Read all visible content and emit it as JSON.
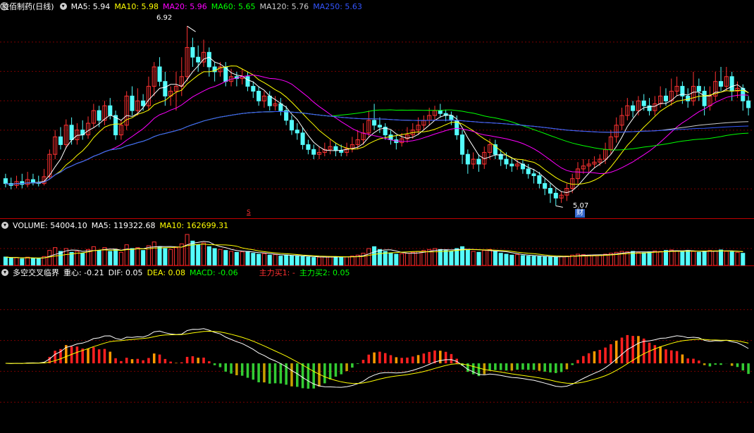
{
  "main": {
    "title": "益佰制药(日线)",
    "ma": [
      {
        "label": "MA5: 5.94",
        "color": "#ffffff"
      },
      {
        "label": "MA10: 5.98",
        "color": "#ffff00"
      },
      {
        "label": "MA20: 5.96",
        "color": "#ff00ff"
      },
      {
        "label": "MA60: 5.65",
        "color": "#00ff00"
      },
      {
        "label": "MA120: 5.76",
        "color": "#cccccc"
      },
      {
        "label": "MA250: 5.63",
        "color": "#3355ff"
      }
    ],
    "high_label": "6.92",
    "low_label": "5.07",
    "marker_s": "S",
    "marker_cai": "财"
  },
  "volume": {
    "items": [
      {
        "label": "VOLUME: 54004.10",
        "color": "#ffffff"
      },
      {
        "label": "MA5: 119322.68",
        "color": "#ffffff"
      },
      {
        "label": "MA10: 162699.31",
        "color": "#ffff00"
      }
    ]
  },
  "indicator": {
    "items": [
      {
        "label": "多空交叉临界",
        "color": "#ffffff"
      },
      {
        "label": "重心: -0.21",
        "color": "#ffffff"
      },
      {
        "label": "DIF: 0.05",
        "color": "#ffffff"
      },
      {
        "label": "DEA: 0.08",
        "color": "#ffff00"
      },
      {
        "label": "MACD: -0.06",
        "color": "#00ff00"
      },
      {
        "label": "主力买1: -",
        "color": "#ff3030"
      },
      {
        "label": "主力买2: 0.05",
        "color": "#00ff00"
      }
    ]
  },
  "colors": {
    "up": "#ff3232",
    "down": "#54fcfc",
    "grid": "#7a0000",
    "separator": "#c00000"
  },
  "chart_data": {
    "type": "candlestick",
    "title": "益佰制药(日线)",
    "price_range": [
      5.0,
      7.0
    ],
    "candles": [
      [
        5.35,
        5.3,
        5.4,
        5.26
      ],
      [
        5.3,
        5.28,
        5.36,
        5.24
      ],
      [
        5.28,
        5.32,
        5.38,
        5.25
      ],
      [
        5.32,
        5.29,
        5.4,
        5.25
      ],
      [
        5.29,
        5.34,
        5.42,
        5.26
      ],
      [
        5.34,
        5.31,
        5.4,
        5.28
      ],
      [
        5.31,
        5.3,
        5.38,
        5.27
      ],
      [
        5.3,
        5.37,
        5.45,
        5.28
      ],
      [
        5.37,
        5.6,
        5.65,
        5.35
      ],
      [
        5.6,
        5.78,
        5.85,
        5.55
      ],
      [
        5.78,
        5.7,
        5.88,
        5.65
      ],
      [
        5.7,
        5.9,
        5.96,
        5.66
      ],
      [
        5.9,
        5.75,
        5.98,
        5.7
      ],
      [
        5.75,
        5.85,
        5.92,
        5.7
      ],
      [
        5.85,
        5.8,
        5.95,
        5.75
      ],
      [
        5.8,
        5.92,
        5.99,
        5.76
      ],
      [
        5.92,
        6.05,
        6.12,
        5.88
      ],
      [
        6.05,
        5.95,
        6.1,
        5.88
      ],
      [
        5.95,
        6.1,
        6.15,
        5.9
      ],
      [
        6.1,
        6.0,
        6.18,
        5.96
      ],
      [
        6.0,
        5.8,
        6.05,
        5.75
      ],
      [
        5.8,
        5.9,
        5.95,
        5.75
      ],
      [
        5.9,
        6.2,
        6.25,
        5.85
      ],
      [
        6.2,
        6.05,
        6.3,
        6.0
      ],
      [
        6.05,
        6.15,
        6.28,
        6.0
      ],
      [
        6.15,
        6.1,
        6.22,
        6.05
      ],
      [
        6.1,
        6.3,
        6.4,
        6.05
      ],
      [
        6.3,
        6.5,
        6.55,
        6.2
      ],
      [
        6.5,
        6.35,
        6.6,
        6.3
      ],
      [
        6.35,
        6.2,
        6.45,
        6.1
      ],
      [
        6.2,
        6.25,
        6.3,
        6.1
      ],
      [
        6.25,
        6.3,
        6.45,
        6.05
      ],
      [
        6.3,
        6.4,
        6.6,
        6.2
      ],
      [
        6.4,
        6.7,
        6.92,
        6.35
      ],
      [
        6.7,
        6.6,
        6.8,
        6.5
      ],
      [
        6.6,
        6.55,
        6.72,
        6.45
      ],
      [
        6.55,
        6.65,
        6.78,
        6.5
      ],
      [
        6.65,
        6.5,
        6.7,
        6.4
      ],
      [
        6.5,
        6.45,
        6.55,
        6.35
      ],
      [
        6.45,
        6.5,
        6.55,
        6.4
      ],
      [
        6.5,
        6.35,
        6.55,
        6.3
      ],
      [
        6.35,
        6.4,
        6.48,
        6.3
      ],
      [
        6.4,
        6.38,
        6.45,
        6.3
      ],
      [
        6.38,
        6.4,
        6.48,
        6.32
      ],
      [
        6.4,
        6.3,
        6.45,
        6.25
      ],
      [
        6.3,
        6.25,
        6.35,
        6.18
      ],
      [
        6.25,
        6.15,
        6.3,
        6.1
      ],
      [
        6.15,
        6.2,
        6.25,
        6.08
      ],
      [
        6.2,
        6.1,
        6.25,
        6.05
      ],
      [
        6.1,
        6.12,
        6.2,
        6.05
      ],
      [
        6.12,
        6.05,
        6.18,
        6.0
      ],
      [
        6.05,
        5.95,
        6.1,
        5.9
      ],
      [
        5.95,
        5.85,
        6.0,
        5.8
      ],
      [
        5.85,
        5.82,
        5.92,
        5.75
      ],
      [
        5.82,
        5.7,
        5.88,
        5.65
      ],
      [
        5.7,
        5.65,
        5.75,
        5.6
      ],
      [
        5.65,
        5.6,
        5.7,
        5.55
      ],
      [
        5.6,
        5.62,
        5.68,
        5.55
      ],
      [
        5.62,
        5.65,
        5.72,
        5.58
      ],
      [
        5.65,
        5.68,
        5.75,
        5.6
      ],
      [
        5.68,
        5.64,
        5.72,
        5.58
      ],
      [
        5.64,
        5.62,
        5.7,
        5.58
      ],
      [
        5.62,
        5.66,
        5.72,
        5.58
      ],
      [
        5.66,
        5.7,
        5.78,
        5.62
      ],
      [
        5.7,
        5.75,
        5.85,
        5.65
      ],
      [
        5.75,
        5.82,
        5.92,
        5.7
      ],
      [
        5.82,
        5.95,
        6.05,
        5.78
      ],
      [
        5.95,
        5.9,
        6.12,
        5.85
      ],
      [
        5.9,
        5.88,
        5.98,
        5.82
      ],
      [
        5.88,
        5.8,
        5.92,
        5.75
      ],
      [
        5.8,
        5.75,
        5.85,
        5.7
      ],
      [
        5.75,
        5.72,
        5.8,
        5.65
      ],
      [
        5.72,
        5.76,
        5.82,
        5.68
      ],
      [
        5.76,
        5.8,
        5.88,
        5.72
      ],
      [
        5.8,
        5.85,
        5.92,
        5.76
      ],
      [
        5.85,
        5.9,
        5.98,
        5.8
      ],
      [
        5.9,
        5.95,
        6.0,
        5.85
      ],
      [
        5.95,
        6.0,
        6.08,
        5.9
      ],
      [
        6.0,
        6.05,
        6.1,
        5.95
      ],
      [
        6.05,
        6.02,
        6.12,
        5.98
      ],
      [
        6.02,
        6.0,
        6.06,
        5.94
      ],
      [
        6.0,
        5.95,
        6.04,
        5.9
      ],
      [
        5.95,
        5.8,
        6.0,
        5.75
      ],
      [
        5.8,
        5.6,
        5.85,
        5.5
      ],
      [
        5.6,
        5.5,
        5.65,
        5.4
      ],
      [
        5.5,
        5.55,
        5.62,
        5.45
      ],
      [
        5.55,
        5.5,
        5.6,
        5.42
      ],
      [
        5.5,
        5.62,
        5.68,
        5.45
      ],
      [
        5.62,
        5.7,
        5.76,
        5.55
      ],
      [
        5.7,
        5.6,
        5.75,
        5.55
      ],
      [
        5.6,
        5.55,
        5.65,
        5.48
      ],
      [
        5.55,
        5.5,
        5.62,
        5.45
      ],
      [
        5.5,
        5.48,
        5.56,
        5.42
      ],
      [
        5.48,
        5.5,
        5.55,
        5.44
      ],
      [
        5.5,
        5.45,
        5.54,
        5.4
      ],
      [
        5.45,
        5.4,
        5.5,
        5.35
      ],
      [
        5.4,
        5.38,
        5.45,
        5.3
      ],
      [
        5.38,
        5.3,
        5.42,
        5.25
      ],
      [
        5.3,
        5.25,
        5.35,
        5.18
      ],
      [
        5.25,
        5.2,
        5.3,
        5.1
      ],
      [
        5.2,
        5.15,
        5.25,
        5.07
      ],
      [
        5.15,
        5.18,
        5.22,
        5.1
      ],
      [
        5.18,
        5.25,
        5.3,
        5.12
      ],
      [
        5.25,
        5.35,
        5.4,
        5.2
      ],
      [
        5.35,
        5.45,
        5.52,
        5.3
      ],
      [
        5.45,
        5.48,
        5.55,
        5.4
      ],
      [
        5.48,
        5.5,
        5.55,
        5.42
      ],
      [
        5.5,
        5.52,
        5.58,
        5.46
      ],
      [
        5.52,
        5.55,
        5.6,
        5.48
      ],
      [
        5.55,
        5.65,
        5.72,
        5.5
      ],
      [
        5.65,
        5.78,
        5.85,
        5.6
      ],
      [
        5.78,
        5.9,
        5.98,
        5.72
      ],
      [
        5.9,
        6.0,
        6.08,
        5.85
      ],
      [
        6.0,
        6.1,
        6.18,
        5.95
      ],
      [
        6.1,
        6.05,
        6.15,
        5.98
      ],
      [
        6.05,
        6.15,
        6.2,
        6.0
      ],
      [
        6.15,
        6.1,
        6.22,
        6.05
      ],
      [
        6.1,
        6.05,
        6.18,
        6.0
      ],
      [
        6.05,
        6.12,
        6.2,
        6.0
      ],
      [
        6.12,
        6.2,
        6.3,
        6.08
      ],
      [
        6.2,
        6.15,
        6.28,
        6.1
      ],
      [
        6.15,
        6.25,
        6.38,
        6.1
      ],
      [
        6.25,
        6.3,
        6.4,
        6.2
      ],
      [
        6.3,
        6.2,
        6.35,
        6.12
      ],
      [
        6.2,
        6.15,
        6.28,
        6.08
      ],
      [
        6.15,
        6.3,
        6.45,
        6.1
      ],
      [
        6.3,
        6.25,
        6.38,
        6.15
      ],
      [
        6.25,
        6.1,
        6.3,
        6.0
      ],
      [
        6.1,
        6.2,
        6.3,
        6.05
      ],
      [
        6.2,
        6.35,
        6.45,
        6.15
      ],
      [
        6.35,
        6.3,
        6.5,
        6.25
      ],
      [
        6.3,
        6.4,
        6.5,
        6.25
      ],
      [
        6.4,
        6.25,
        6.45,
        6.15
      ],
      [
        6.25,
        6.28,
        6.35,
        6.18
      ],
      [
        6.28,
        6.15,
        6.32,
        6.05
      ],
      [
        6.15,
        6.08,
        6.2,
        6.0
      ]
    ],
    "ma_lines": {
      "MA5": {
        "value": 5.94,
        "color": "#ffffff"
      },
      "MA10": {
        "value": 5.98,
        "color": "#ffff00"
      },
      "MA20": {
        "value": 5.96,
        "color": "#ff00ff"
      },
      "MA60": {
        "value": 5.65,
        "color": "#00ff00"
      },
      "MA120": {
        "value": 5.76,
        "color": "#cccccc"
      },
      "MA250": {
        "value": 5.63,
        "color": "#3355ff"
      }
    },
    "volume": [
      90,
      80,
      85,
      70,
      88,
      75,
      70,
      95,
      160,
      190,
      150,
      180,
      140,
      150,
      130,
      170,
      200,
      160,
      190,
      150,
      170,
      140,
      220,
      180,
      190,
      160,
      210,
      250,
      200,
      180,
      170,
      190,
      230,
      330,
      260,
      220,
      240,
      200,
      180,
      170,
      160,
      150,
      140,
      145,
      150,
      130,
      120,
      125,
      110,
      115,
      100,
      110,
      105,
      100,
      95,
      90,
      85,
      88,
      90,
      95,
      92,
      88,
      90,
      100,
      110,
      130,
      180,
      200,
      170,
      150,
      130,
      120,
      125,
      130,
      140,
      150,
      160,
      170,
      180,
      170,
      160,
      150,
      180,
      200,
      170,
      150,
      140,
      160,
      170,
      150,
      130,
      120,
      110,
      115,
      105,
      100,
      98,
      95,
      92,
      90,
      88,
      95,
      100,
      110,
      120,
      115,
      110,
      108,
      112,
      120,
      130,
      140,
      150,
      145,
      150,
      140,
      135,
      145,
      155,
      150,
      160,
      165,
      155,
      150,
      160,
      150,
      140,
      150,
      160,
      155,
      165,
      150,
      145,
      140,
      130
    ],
    "indicator_values": {
      "重心": -0.21,
      "DIF": 0.05,
      "DEA": 0.08,
      "MACD": -0.06,
      "主力买2": 0.05
    },
    "macd_range": [
      -0.45,
      0.55
    ]
  }
}
